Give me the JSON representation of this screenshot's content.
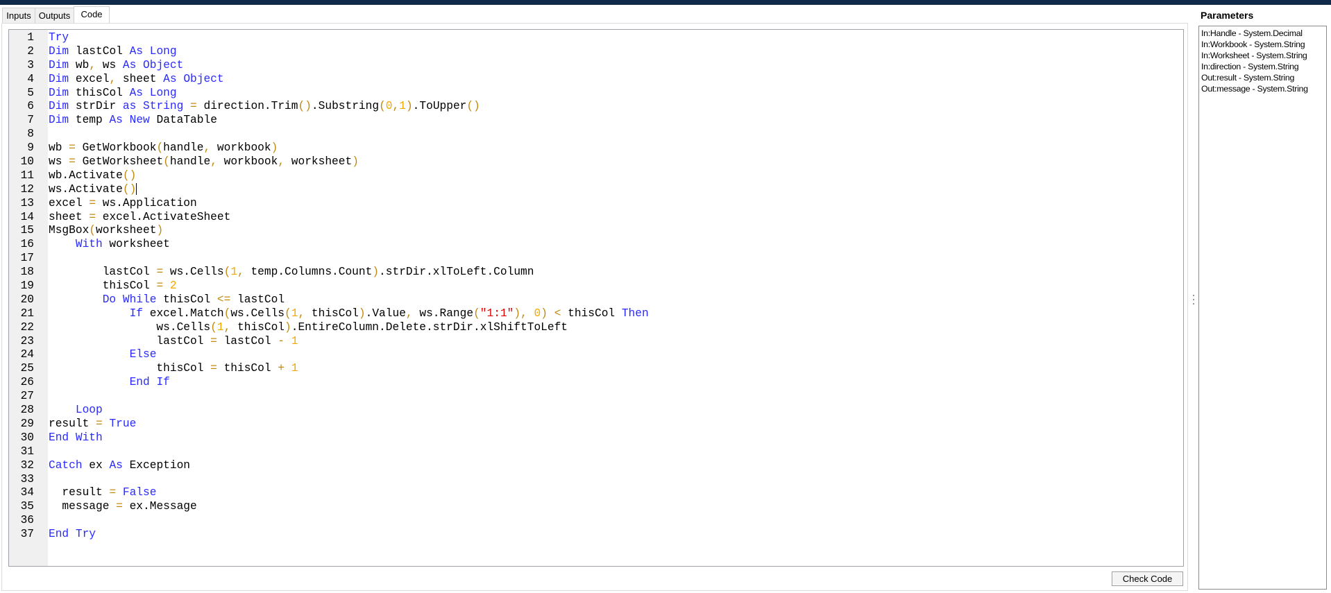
{
  "tabs": [
    {
      "label": "Inputs"
    },
    {
      "label": "Outputs"
    },
    {
      "label": "Code"
    }
  ],
  "active_tab": "Code",
  "code": {
    "lines": [
      "Try",
      "Dim lastCol As Long",
      "Dim wb, ws As Object",
      "Dim excel, sheet As Object",
      "Dim thisCol As Long",
      "Dim strDir as String = direction.Trim().Substring(0,1).ToUpper()",
      "Dim temp As New DataTable",
      "",
      "wb = GetWorkbook(handle, workbook)",
      "ws = GetWorksheet(handle, workbook, worksheet)",
      "wb.Activate()",
      "ws.Activate()",
      "excel = ws.Application",
      "sheet = excel.ActivateSheet",
      "MsgBox(worksheet)",
      "    With worksheet",
      "",
      "        lastCol = ws.Cells(1, temp.Columns.Count).strDir.xlToLeft.Column",
      "        thisCol = 2",
      "        Do While thisCol <= lastCol",
      "            If excel.Match(ws.Cells(1, thisCol).Value, ws.Range(\"1:1\"), 0) < thisCol Then",
      "                ws.Cells(1, thisCol).EntireColumn.Delete.strDir.xlShiftToLeft",
      "                lastCol = lastCol - 1",
      "            Else",
      "                thisCol = thisCol + 1",
      "            End If",
      "",
      "    Loop",
      "result = True",
      "End With",
      "",
      "Catch ex As Exception",
      "",
      "  result = False",
      "  message = ex.Message",
      "",
      "End Try"
    ]
  },
  "check_code_label": "Check Code",
  "parameters": {
    "title": "Parameters",
    "items": [
      "In:Handle - System.Decimal",
      "In:Workbook - System.String",
      "In:Worksheet - System.String",
      "In:direction - System.String",
      "Out:result - System.String",
      "Out:message - System.String"
    ]
  },
  "colors": {
    "keyword": "#2a2aff",
    "number": "#f2a900",
    "operator": "#c08a10",
    "string": "#e00000",
    "topbar": "#0f2a4a"
  }
}
